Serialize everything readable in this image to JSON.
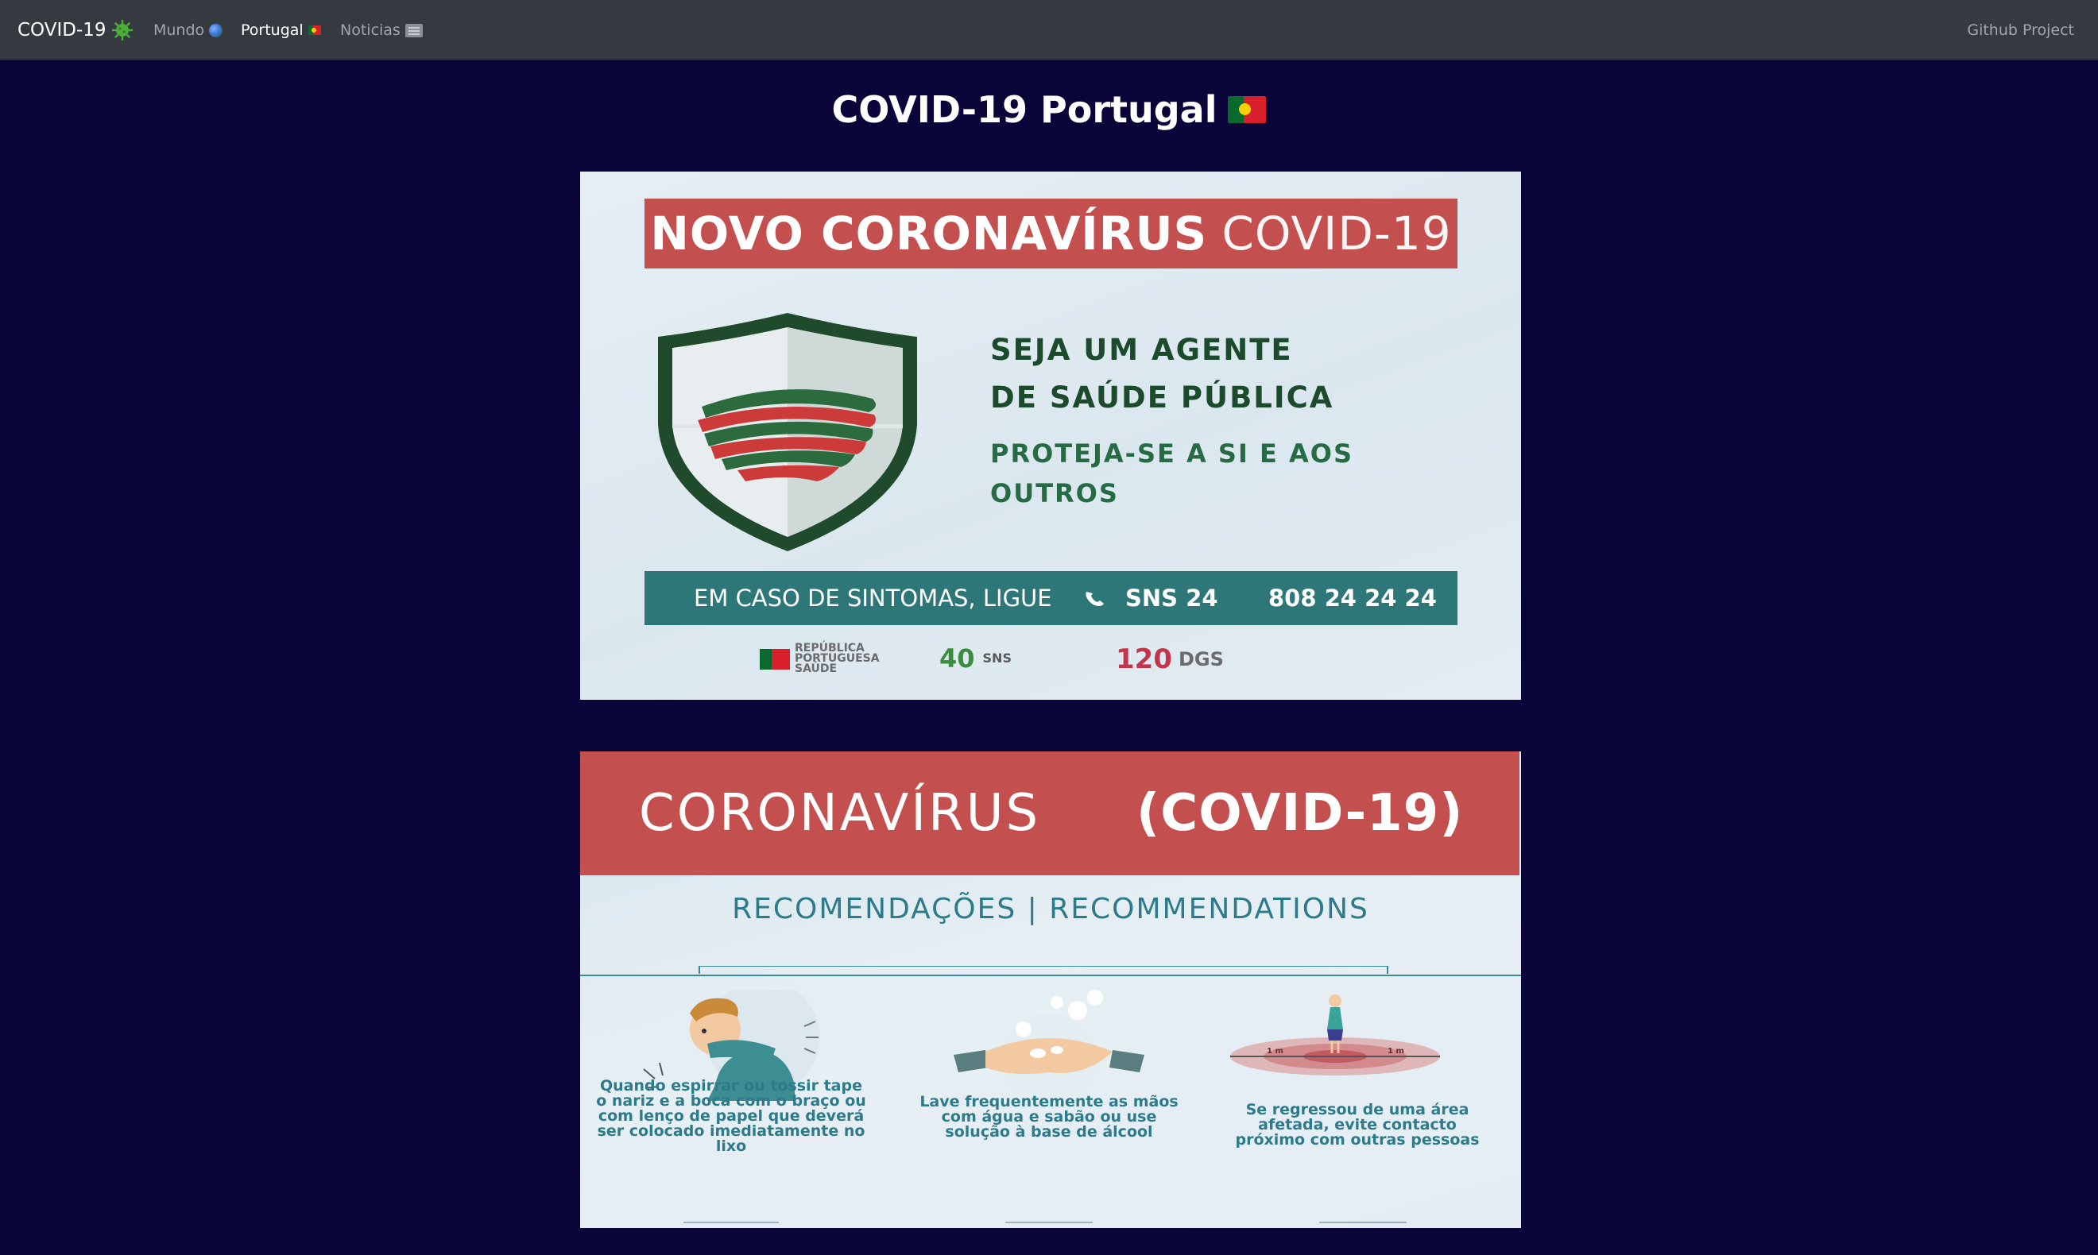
{
  "navbar": {
    "brand": "COVID-19",
    "brand_icon": "virus-icon",
    "links": [
      {
        "label": "Mundo",
        "icon": "globe-icon",
        "active": false
      },
      {
        "label": "Portugal",
        "icon": "portugal-flag-icon",
        "active": true
      },
      {
        "label": "Noticias",
        "icon": "newspaper-icon",
        "active": false
      }
    ],
    "github": "Github Project"
  },
  "page": {
    "title": "COVID-19 Portugal",
    "title_icon": "portugal-flag-icon"
  },
  "poster1": {
    "banner_bold": "NOVO CORONAVÍRUS",
    "banner_light": "COVID-19",
    "headline_1": "SEJA UM AGENTE",
    "headline_2": "DE SAÚDE PÚBLICA",
    "sub_1": "PROTEJA-SE A SI E AOS",
    "sub_2": "OUTROS",
    "call_text": "EM CASO DE SINTOMAS, LIGUE",
    "call_service": "SNS 24",
    "call_number": "808 24 24 24",
    "logo_rp_1": "REPÚBLICA",
    "logo_rp_2": "PORTUGUESA",
    "logo_rp_3": "SAÚDE",
    "logo_sns": "SNS",
    "logo_40": "40",
    "logo_120": "120",
    "logo_dgs": "DGS"
  },
  "poster2": {
    "header_light": "CORONAVÍRUS",
    "header_bold": "(COVID-19)",
    "subtitle": "RECOMENDAÇÕES | RECOMMENDATIONS",
    "caption_1": "Quando espirrar ou tossir tape o nariz e a boca com o braço ou com lenço de papel que deverá ser colocado imediatamente no lixo",
    "caption_2": "Lave frequentemente as mãos com água e sabão ou use solução à base de álcool",
    "caption_3": "Se regressou de uma área afetada, evite contacto próximo com outras pessoas",
    "distance_label": "1 m"
  },
  "colors": {
    "background": "#0a0538",
    "navbar": "#353a40",
    "poster_red": "#c3504e",
    "poster_teal": "#2e7778",
    "poster_green": "#1c4a2c"
  }
}
